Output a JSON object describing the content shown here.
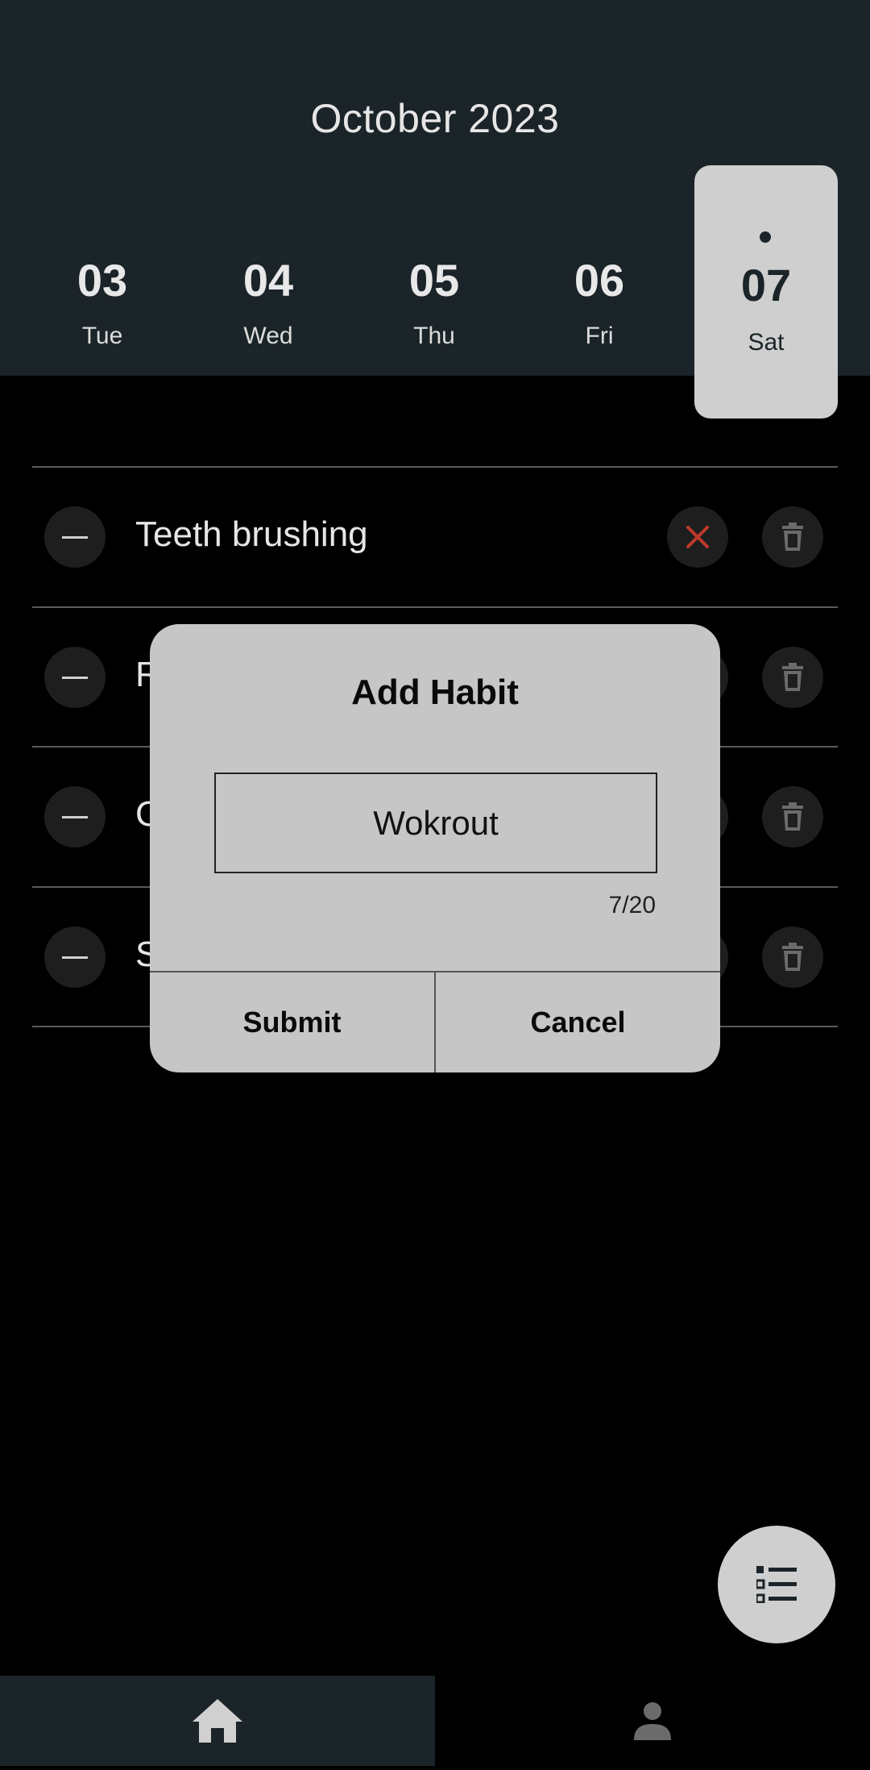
{
  "header": {
    "month_title": "October 2023",
    "days": [
      {
        "num": "03",
        "dow": "Tue"
      },
      {
        "num": "04",
        "dow": "Wed"
      },
      {
        "num": "05",
        "dow": "Thu"
      },
      {
        "num": "06",
        "dow": "Fri"
      },
      {
        "num": "07",
        "dow": "Sat"
      }
    ],
    "selected_day_index": 4
  },
  "habits": [
    {
      "name": "Teeth brushing",
      "status": "missed"
    },
    {
      "name": "R"
    },
    {
      "name": "G"
    },
    {
      "name": "S"
    }
  ],
  "dialog": {
    "title": "Add Habit",
    "input_value": "Wokrout",
    "counter": "7/20",
    "submit_label": "Submit",
    "cancel_label": "Cancel"
  },
  "fab": {
    "icon": "list-icon"
  },
  "bottom_nav": {
    "tabs": [
      {
        "icon": "home-icon",
        "active": true
      },
      {
        "icon": "person-icon",
        "active": false
      }
    ]
  },
  "colors": {
    "header_bg": "#1b2428",
    "selected_day_bg": "#cfcfcf",
    "dialog_bg": "#c6c6c6",
    "missed_x": "#c0392b"
  }
}
